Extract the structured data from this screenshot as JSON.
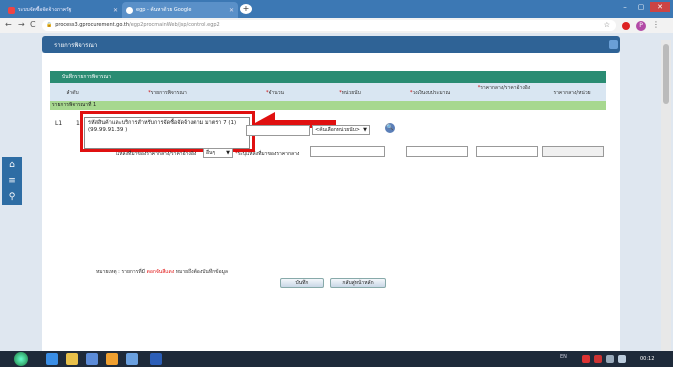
{
  "browser": {
    "tabs": [
      {
        "label": "ระบบจัดซื้อจัดจ้างภาครัฐ",
        "active": false
      },
      {
        "label": "egp - ค้นหาด้วย Google",
        "active": true
      }
    ],
    "new_tab": "+",
    "window_controls": {
      "minimize": "–",
      "maximize": "▢",
      "close": "✕"
    },
    "url_host": "process3.gprocurement.go.th",
    "url_path": "/egp2procmainWeb/jsp/control.egp2",
    "profile_letter": "P",
    "nav": {
      "back": "←",
      "forward": "→",
      "reload": "C"
    },
    "menu": "⋮",
    "star": "☆",
    "lock": "🔒"
  },
  "page": {
    "header_title": "รายการพิจารณา",
    "section_title": "บันทึกรายการพิจารณา",
    "columns": [
      {
        "label": "ลำดับ",
        "required": false
      },
      {
        "label": "รายการพิจารณา",
        "required": true
      },
      {
        "label": "จำนวน",
        "required": true
      },
      {
        "label": "หน่วยนับ",
        "required": true
      },
      {
        "label": "วงเงินงบประมาณ",
        "required": true
      },
      {
        "label": "ราคากลาง/ราคาอ้างอิง",
        "required": true
      },
      {
        "label": "ราคากลาง/หน่วย",
        "required": false
      }
    ],
    "group_label": "รายการพิจารณาที่ 1",
    "row": {
      "no": "L1",
      "index": "1",
      "item_text": "รหัสสินค้าและบริการสำหรับการจัดซื้อจัดจ้างตาม มาตรา 7 (1)(99.99.91.39 )",
      "unit_select": "<ค้นเลือกหน่วยนับ>",
      "source_label": "แหล่งที่มาของราคากลาง/ราคาอ้างอิง",
      "source_select": "อื่นๆ",
      "source_other_label": "ระบุแหล่งที่มาของราคากลาง"
    },
    "note_prefix": "หมายเหตุ : รายการที่มี",
    "note_highlight": "ดอกจันสีแดง",
    "note_suffix": "หมายถึงต้องบันทึกข้อมูล",
    "buttons": {
      "save": "บันทึก",
      "back": "กลับสู่หน้าหลัก"
    },
    "side_tools": [
      "home-icon",
      "menu-icon",
      "search-icon"
    ]
  },
  "taskbar": {
    "tray_lang": "EN",
    "clock": "00:12"
  },
  "colors": {
    "header": "#2f6396",
    "section": "#2a8c73",
    "group_row": "#a7d88f",
    "highlight": "#e01010"
  }
}
